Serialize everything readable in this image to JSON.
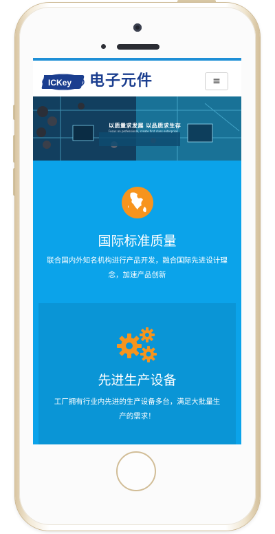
{
  "header": {
    "logo_text": "ICKey",
    "brand": "电子元件",
    "menu_icon": "≡"
  },
  "banner": {
    "slogan": "以质量求发展 以品质求生存",
    "subline": "Focus on professional, create first class enterprise"
  },
  "features": [
    {
      "icon": "globe-icon",
      "title": "国际标准质量",
      "desc": "联合国内外知名机构进行产品开发，融合国际先进设计理念，加速产品创新"
    },
    {
      "icon": "gears-icon",
      "title": "先进生产设备",
      "desc": "工厂拥有行业内先进的生产设备多台，满足大批量生产的需求！"
    }
  ],
  "colors": {
    "primary": "#0ba3ea",
    "panel": "#0a95d6",
    "accent": "#f7941d",
    "brand": "#1b3e8f"
  }
}
